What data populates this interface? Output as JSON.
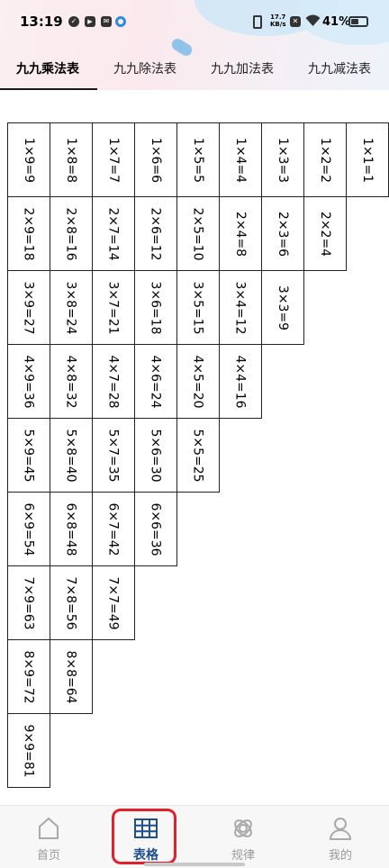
{
  "status_bar": {
    "time": "13:19",
    "network_speed_value": "17.7",
    "network_speed_unit": "KB/s",
    "battery": "41%"
  },
  "tabs": [
    {
      "label": "九九乘法表",
      "active": true
    },
    {
      "label": "九九除法表",
      "active": false
    },
    {
      "label": "九九加法表",
      "active": false
    },
    {
      "label": "九九减法表",
      "active": false
    }
  ],
  "table": [
    [
      "1×1=1"
    ],
    [
      "1×2=2",
      "2×2=4"
    ],
    [
      "1×3=3",
      "2×3=6",
      "3×3=9"
    ],
    [
      "1×4=4",
      "2×4=8",
      "3×4=12",
      "4×4=16"
    ],
    [
      "1×5=5",
      "2×5=10",
      "3×5=15",
      "4×5=20",
      "5×5=25"
    ],
    [
      "1×6=6",
      "2×6=12",
      "3×6=18",
      "4×6=24",
      "5×6=30",
      "6×6=36"
    ],
    [
      "1×7=7",
      "2×7=14",
      "3×7=21",
      "4×7=28",
      "5×7=35",
      "6×7=42",
      "7×7=49"
    ],
    [
      "1×8=8",
      "2×8=16",
      "3×8=24",
      "4×8=32",
      "5×8=40",
      "6×8=48",
      "7×8=56",
      "8×8=64"
    ],
    [
      "1×9=9",
      "2×9=18",
      "3×9=27",
      "4×9=36",
      "5×9=45",
      "6×9=54",
      "7×9=63",
      "8×9=72",
      "9×9=81"
    ]
  ],
  "bottom_nav": [
    {
      "label": "首页",
      "icon": "home-icon",
      "active": false
    },
    {
      "label": "表格",
      "icon": "table-grid-icon",
      "active": true
    },
    {
      "label": "规律",
      "icon": "pattern-icon",
      "active": false
    },
    {
      "label": "我的",
      "icon": "user-icon",
      "active": false
    }
  ],
  "colors": {
    "active_nav": "#1f4f8f",
    "inactive_nav": "#9a9a9a",
    "highlight": "#e0202a"
  }
}
